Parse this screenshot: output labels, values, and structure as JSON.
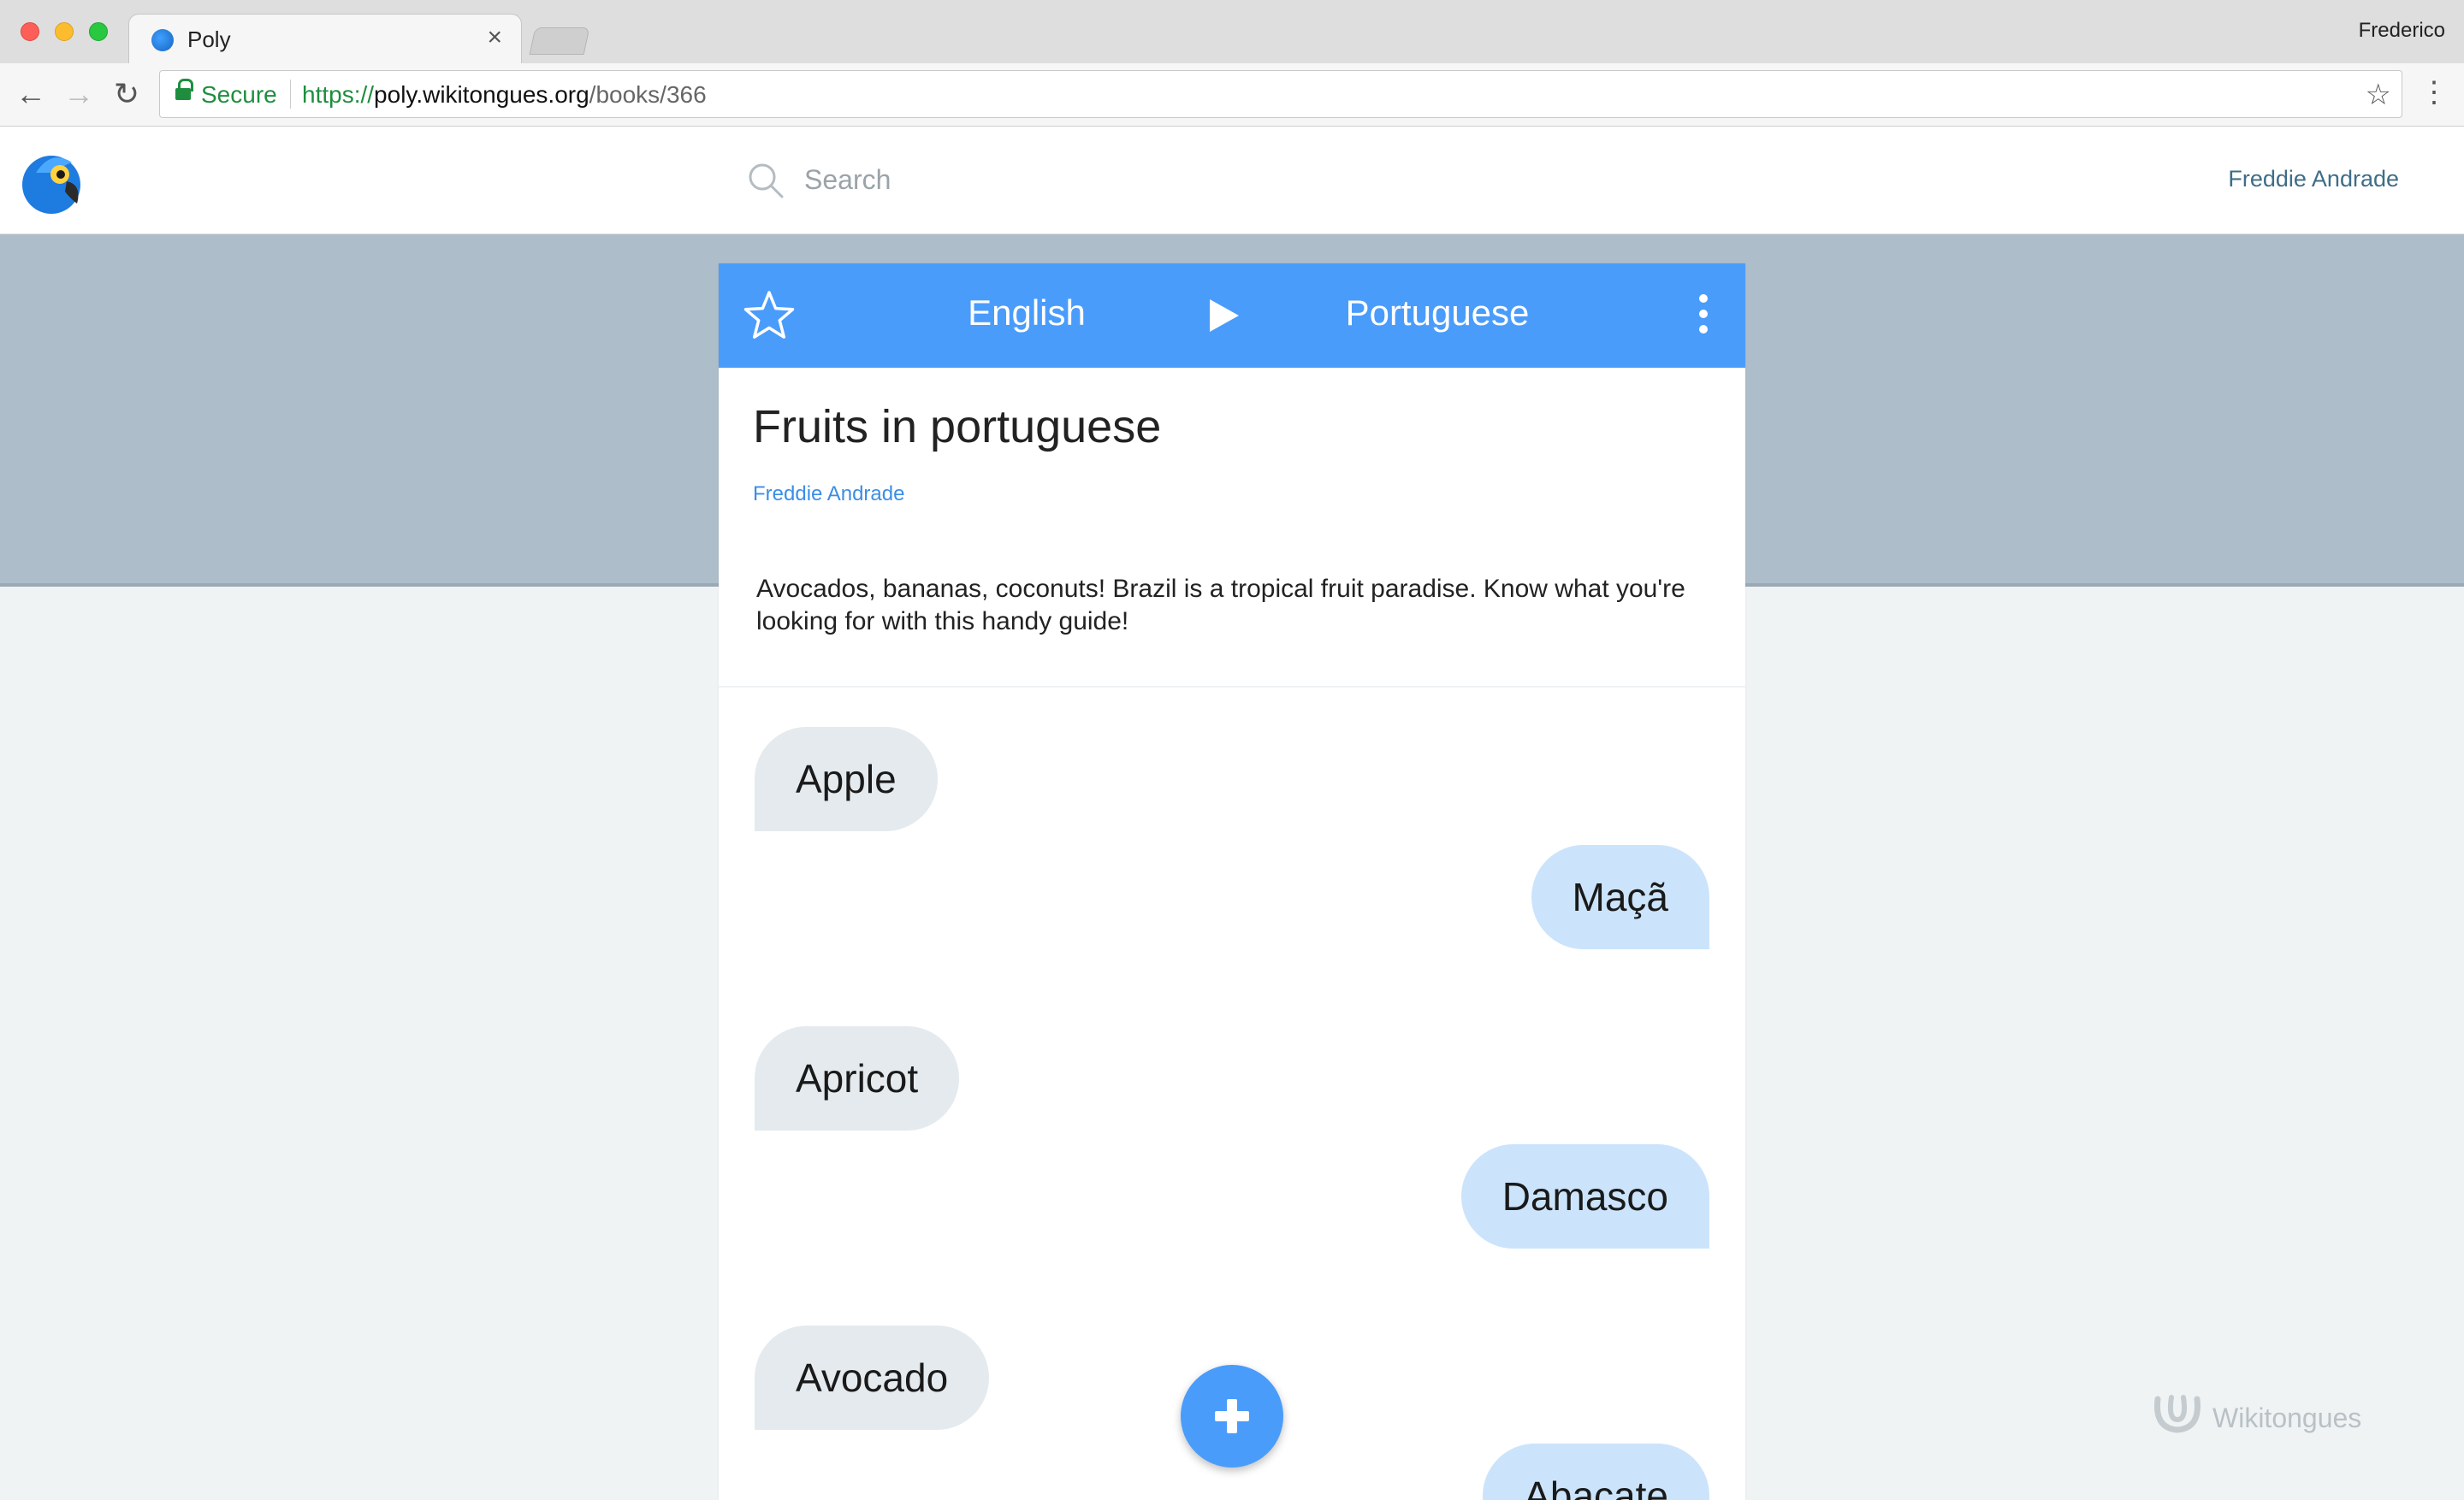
{
  "browser": {
    "tab_title": "Poly",
    "profile_name": "Frederico",
    "secure_label": "Secure",
    "url_scheme": "https://",
    "url_host": "poly.wikitongues.org",
    "url_path": "/books/366"
  },
  "header": {
    "search_placeholder": "Search",
    "user_name": "Freddie Andrade"
  },
  "book": {
    "language_from": "English",
    "language_to": "Portuguese",
    "title": "Fruits in portuguese",
    "author": "Freddie Andrade",
    "description": "Avocados, bananas, coconuts! Brazil is a tropical fruit paradise. Know what you're looking for with this handy guide!",
    "phrases": [
      {
        "source": "Apple",
        "target": "Maçã"
      },
      {
        "source": "Apricot",
        "target": "Damasco"
      },
      {
        "source": "Avocado",
        "target": "Abacate"
      }
    ]
  },
  "footer": {
    "brand": "Wikitongues"
  },
  "colors": {
    "accent": "#4a9cfb",
    "band": "#aebdca",
    "source_bubble": "#e4eaee",
    "target_bubble": "#cbe4fb",
    "secure_green": "#1e8e3e"
  }
}
